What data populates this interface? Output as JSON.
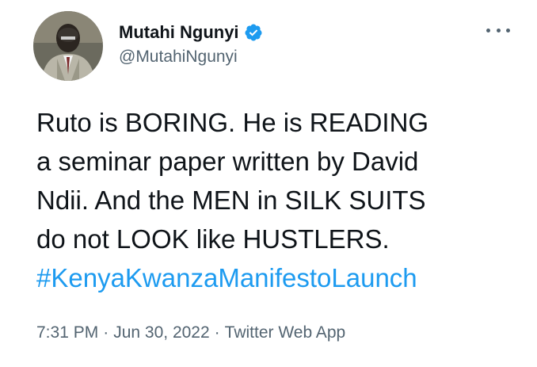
{
  "author": {
    "display_name": "Mutahi Ngunyi",
    "handle": "@MutahiNgunyi",
    "verified_icon": "verified-badge-icon",
    "verified_color": "#1d9bf0"
  },
  "menu": {
    "icon": "more-options-icon"
  },
  "tweet": {
    "lines": [
      "Ruto is BORING. He is READING",
      "a seminar paper written by David",
      "Ndii. And the MEN in SILK SUITS",
      "do not LOOK like HUSTLERS."
    ],
    "hashtag": "#KenyaKwanzaManifestoLaunch",
    "hashtag_color": "#1d9bf0"
  },
  "meta": {
    "time": "7:31 PM",
    "separator": "·",
    "date": "Jun 30, 2022",
    "source": "Twitter Web App"
  }
}
